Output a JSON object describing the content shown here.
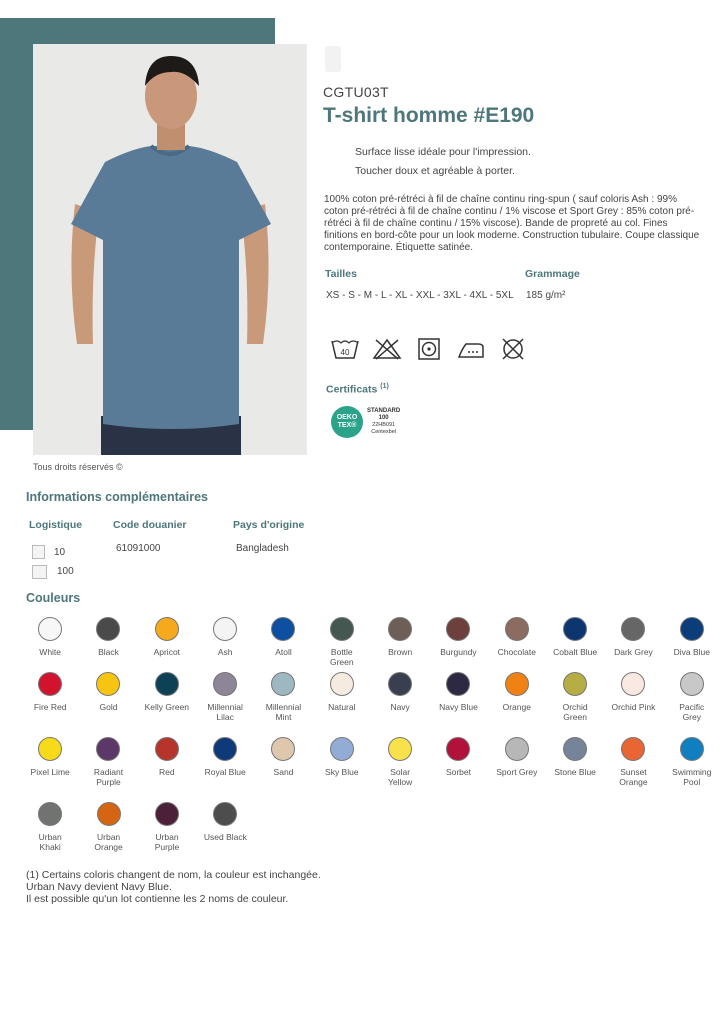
{
  "product": {
    "reference": "CGTU03T",
    "title": "T-shirt homme #E190",
    "features": [
      "Surface lisse idéale pour l'impression.",
      "Toucher doux et agréable à porter."
    ],
    "description": "100% coton pré-rétréci à fil de chaîne continu ring-spun ( sauf coloris Ash : 99% coton pré-rétréci à fil de chaîne continu / 1% viscose et Sport Grey : 85% coton pré-rétréci à fil de chaîne continu / 15% viscose). Bande de propreté au col. Fines finitions en bord-côte pour un look moderne. Construction tubulaire. Coupe classique contemporaine. Étiquette satinée.",
    "rights": "Tous droits réservés ©"
  },
  "specs": {
    "sizes_label": "Tailles",
    "sizes_value": "XS - S - M - L - XL - XXL - 3XL - 4XL - 5XL",
    "weight_label": "Grammage",
    "weight_value": "185 g/m²",
    "care_icons": [
      "wash-40-icon",
      "no-bleach-icon",
      "tumble-dry-icon",
      "iron-icon",
      "no-dry-clean-icon"
    ],
    "care_wash_temp": "40",
    "cert_label": "Certificats",
    "cert_note_mark": "(1)",
    "oeko": {
      "line1": "OEKO",
      "line2": "TEX®",
      "standard": "STANDARD",
      "num": "100",
      "code": "22HB091",
      "inst": "Centexbel"
    }
  },
  "info": {
    "title": "Informations complémentaires",
    "logistics_label": "Logistique",
    "customs_label": "Code douanier",
    "origin_label": "Pays d'origine",
    "pack_small": "10",
    "pack_large": "100",
    "customs_code": "61091000",
    "origin": "Bangladesh"
  },
  "colors_title": "Couleurs",
  "colors": [
    {
      "name": "White",
      "hex": "#f7f7f7"
    },
    {
      "name": "Black",
      "hex": "#4a4a4a"
    },
    {
      "name": "Apricot",
      "hex": "#f5a91c"
    },
    {
      "name": "Ash",
      "hex": "#f4f4f4"
    },
    {
      "name": "Atoll",
      "hex": "#0d4fa0"
    },
    {
      "name": "Bottle\nGreen",
      "hex": "#445751"
    },
    {
      "name": "Brown",
      "hex": "#6d5e58"
    },
    {
      "name": "Burgundy",
      "hex": "#6e403d"
    },
    {
      "name": "Chocolate",
      "hex": "#8c6b60"
    },
    {
      "name": "Cobalt Blue",
      "hex": "#0d3670"
    },
    {
      "name": "Dark Grey",
      "hex": "#666666"
    },
    {
      "name": "Diva Blue",
      "hex": "#0b3d7a"
    },
    {
      "name": "Fire Red",
      "hex": "#d1132d"
    },
    {
      "name": "Gold",
      "hex": "#f8c412"
    },
    {
      "name": "Kelly Green",
      "hex": "#0d4256"
    },
    {
      "name": "Millennial\nLilac",
      "hex": "#8d8598"
    },
    {
      "name": "Millennial\nMint",
      "hex": "#9eb8c2"
    },
    {
      "name": "Natural",
      "hex": "#f5ebe1"
    },
    {
      "name": "Navy",
      "hex": "#3a3f50"
    },
    {
      "name": "Navy Blue",
      "hex": "#2e2942"
    },
    {
      "name": "Orange",
      "hex": "#f08213"
    },
    {
      "name": "Orchid\nGreen",
      "hex": "#b4ae44"
    },
    {
      "name": "Orchid Pink",
      "hex": "#fae8e3"
    },
    {
      "name": "Pacific\nGrey",
      "hex": "#c8c8c8"
    },
    {
      "name": "Pixel Lime",
      "hex": "#f7da19"
    },
    {
      "name": "Radiant\nPurple",
      "hex": "#5b3867"
    },
    {
      "name": "Red",
      "hex": "#b7342c"
    },
    {
      "name": "Royal Blue",
      "hex": "#0e3a7a"
    },
    {
      "name": "Sand",
      "hex": "#dfc7ad"
    },
    {
      "name": "Sky Blue",
      "hex": "#93acd6"
    },
    {
      "name": "Solar\nYellow",
      "hex": "#f9e14c"
    },
    {
      "name": "Sorbet",
      "hex": "#b2123a"
    },
    {
      "name": "Sport Grey",
      "hex": "#b7b7b7"
    },
    {
      "name": "Stone Blue",
      "hex": "#76849a"
    },
    {
      "name": "Sunset\nOrange",
      "hex": "#ea6534"
    },
    {
      "name": "Swimming\nPool",
      "hex": "#0f7fc2"
    },
    {
      "name": "Urban\nKhaki",
      "hex": "#707370"
    },
    {
      "name": "Urban\nOrange",
      "hex": "#d56512"
    },
    {
      "name": "Urban\nPurple",
      "hex": "#4c2038"
    },
    {
      "name": "Used Black",
      "hex": "#4d4d4d"
    }
  ],
  "footnote": {
    "line1": "(1) Certains coloris changent de nom, la couleur est inchangée.",
    "line2": "Urban Navy devient Navy Blue.",
    "line3": "Il est possible qu'un lot contienne les 2 noms de couleur."
  },
  "accent_color": "#4d777b"
}
